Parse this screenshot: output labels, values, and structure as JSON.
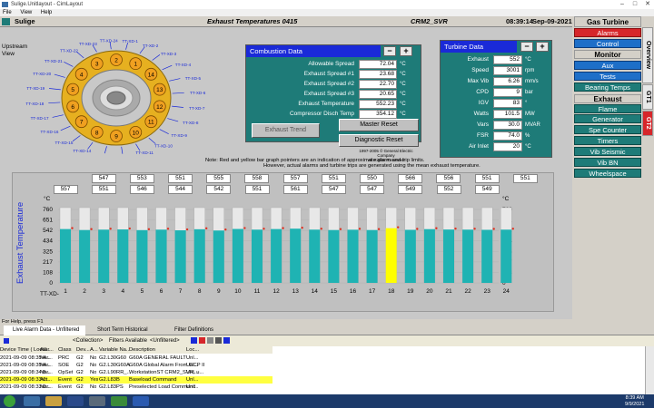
{
  "window": {
    "title": "Sulige.Unitlayout - CimLayout",
    "menu": [
      "File",
      "View",
      "Help"
    ]
  },
  "header": {
    "site": "Sulige",
    "screen_title": "Exhaust Temperatures 0415",
    "unit": "CRM2_SVR",
    "time": "08:39:14",
    "date": "Sep-09-2021"
  },
  "upstream_label": [
    "Upstream",
    "View"
  ],
  "combustor_cans": [
    "1",
    "2",
    "3",
    "4",
    "5",
    "6",
    "7",
    "8",
    "9",
    "10",
    "11",
    "12",
    "13",
    "14"
  ],
  "tc_labels": [
    "TT-XD-1",
    "TT-XD-2",
    "TT-XD-3",
    "TT-XD-4",
    "TT-XD-5",
    "TT-XD-6",
    "TT-XD-7",
    "TT-XD-8",
    "TT-XD-9",
    "TT-XD-10",
    "TT-XD-11",
    "TT-XD-12",
    "TT-XD-13",
    "TT-XD-14",
    "TT-XD-15",
    "TT-XD-16",
    "TT-XD-17",
    "TT-XD-18",
    "TT-XD-19",
    "TT-XD-20",
    "TT-XD-21",
    "TT-XD-22",
    "TT-XD-23",
    "TT-XD-24"
  ],
  "combustion": {
    "title": "Combustion Data",
    "rows": [
      {
        "label": "Allowable Spread",
        "value": "72.04",
        "unit": "°C"
      },
      {
        "label": "Exhaust Spread #1",
        "value": "23.68",
        "unit": "°C"
      },
      {
        "label": "Exhaust Spread #2",
        "value": "22.70",
        "unit": "°C"
      },
      {
        "label": "Exhaust Spread #3",
        "value": "20.65",
        "unit": "°C"
      },
      {
        "label": "Exhaust Temperature",
        "value": "552.23",
        "unit": "°C"
      },
      {
        "label": "Compressor Disch Temp",
        "value": "354.12",
        "unit": "°C"
      }
    ]
  },
  "turbine": {
    "title": "Turbine Data",
    "rows": [
      {
        "label": "Exhaust",
        "value": "552",
        "unit": "°C"
      },
      {
        "label": "Speed",
        "value": "3001",
        "unit": "rpm"
      },
      {
        "label": "Max Vib",
        "value": "6.26",
        "unit": "mm/s"
      },
      {
        "label": "CPD",
        "value": "9",
        "unit": "bar"
      },
      {
        "label": "IGV",
        "value": "83",
        "unit": "°"
      },
      {
        "label": "Watts",
        "value": "101.5",
        "unit": "MW"
      },
      {
        "label": "Vars",
        "value": "30.0",
        "unit": "MVAR"
      },
      {
        "label": "FSR",
        "value": "74.0",
        "unit": "%"
      },
      {
        "label": "Air Inlet",
        "value": "20",
        "unit": "°C"
      }
    ]
  },
  "buttons": {
    "exhaust_trend": "Exhaust Trend",
    "master_reset": "Master Reset",
    "diagnostic_reset": "Diagnostic Reset",
    "minus": "−",
    "plus": "+"
  },
  "copyright": [
    "1997-2005 © General Electric Company",
    "All Rights Reserved"
  ],
  "note": [
    "Note:  Red and yellow bar graph pointers are an indication of approximate alarm and trip limits.",
    "However, actual alarms and turbine trips are generated using the   mean    exhaust temperature."
  ],
  "chart_data": {
    "type": "bar",
    "ylabel": "Exhaust Temperature",
    "unit": "°C",
    "ylim": [
      0,
      760
    ],
    "yticks": [
      "760",
      "651",
      "542",
      "434",
      "325",
      "217",
      "108",
      "0"
    ],
    "x_prefix": "TT-XD-",
    "categories": [
      "1",
      "2",
      "3",
      "4",
      "5",
      "6",
      "7",
      "8",
      "9",
      "10",
      "11",
      "12",
      "13",
      "14",
      "15",
      "16",
      "17",
      "18",
      "19",
      "20",
      "21",
      "22",
      "23",
      "24"
    ],
    "values": [
      557,
      547,
      551,
      553,
      546,
      551,
      544,
      555,
      542,
      558,
      551,
      557,
      561,
      551,
      547,
      550,
      547,
      566,
      549,
      556,
      552,
      551,
      549,
      551
    ],
    "highlight": "18",
    "series_color": "#1fb3b3",
    "highlight_color": "#ffff00"
  },
  "nav": {
    "title": "Gas Turbine",
    "items": [
      "Alarms",
      "Control",
      "Monitor",
      "Aux",
      "Tests",
      "Bearing Temps",
      "Exhaust",
      "Flame",
      "Generator",
      "Spe Counter",
      "Timers",
      "Vib Seismic",
      "Vib BN",
      "Wheelspace"
    ],
    "vtabs": [
      "Overview",
      "GT1",
      "GT2"
    ]
  },
  "status_text": "For Help, press F1",
  "alarm_tabs": [
    "Live Alarm Data - Unfiltered",
    "Short Term Historical Alarms",
    "Filter Definitions"
  ],
  "alarm_toolbar": {
    "collection": "<Collection>",
    "filters": "Filters Available",
    "unfiltered": "<Unfiltered>"
  },
  "alarm_columns": [
    "Device Time ( Local...",
    "Alar...",
    "Class",
    "Dev...",
    "A...",
    "Variable Na...",
    "Description",
    "Loc..."
  ],
  "alarms": [
    [
      "2021-09-09 08:35:4...",
      "Nor...",
      "PRC",
      "G2",
      "No",
      "G2.L30G60",
      "G60A GENERAL FAULT",
      "Unl..."
    ],
    [
      "2021-09-09 08:35:4...",
      "Nor...",
      "SOE",
      "G2",
      "No",
      "G2.L30G60A",
      "G60A Global Alarm From GCP II",
      "Unl..."
    ],
    [
      "2021-09-09 08:34:5...",
      "Nor...",
      "OpSet",
      "G2",
      "No",
      "G2.L90RR_...",
      "WorkstationST CRM2_SVR, u...",
      "Unl..."
    ],
    [
      "2021-09-09 08:33:0...",
      "Act...",
      "Event",
      "G2",
      "Yes",
      "G2.L83B",
      "Baseload Command",
      "Unl..."
    ],
    [
      "2021-09-09 08:33:0...",
      "Nor...",
      "Event",
      "G2",
      "No",
      "G2.L83PS",
      "Preselected Load Command",
      "Unl..."
    ]
  ],
  "tray": {
    "time": "8:39 AM",
    "date": "9/9/2021"
  }
}
